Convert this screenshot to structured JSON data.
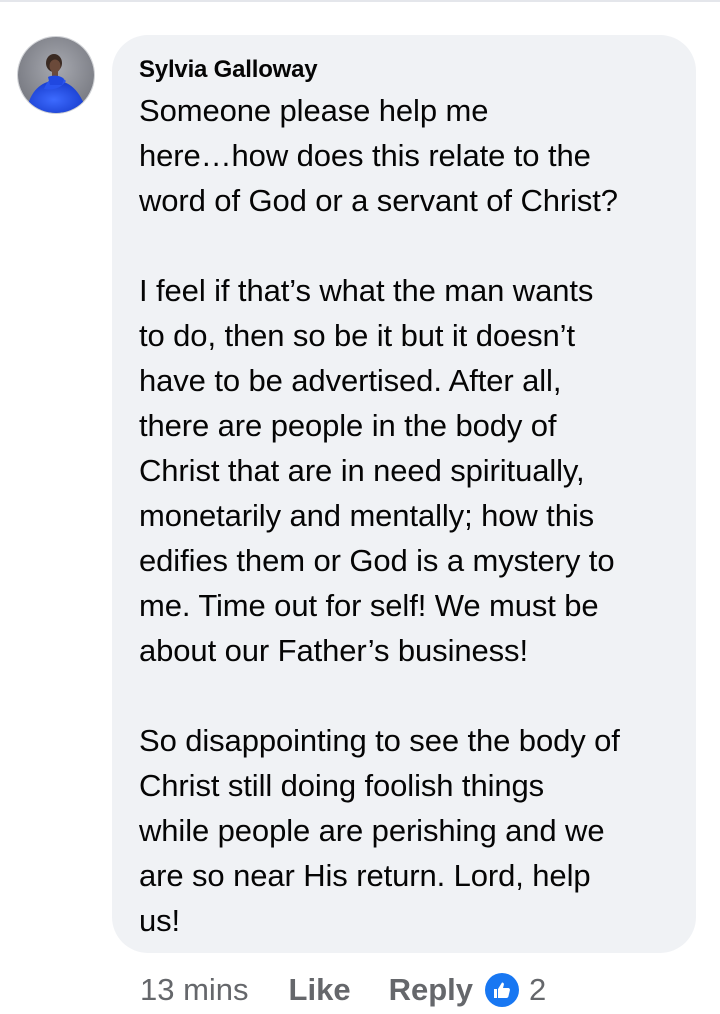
{
  "comment": {
    "author": "Sylvia Galloway",
    "text": "Someone please help me\nhere…how does this relate to the\nword of God or a servant of Christ?\n\nI feel if that’s what the man wants\nto do, then so be it but it doesn’t\nhave to be advertised. After all,\nthere are people in the body of\nChrist that are in need spiritually,\nmonetarily and mentally; how this\nedifies them or God is a mystery to\nme. Time out for self! We must be\nabout our Father’s business!\n\nSo disappointing to see the body of\nChrist still doing foolish things\nwhile people are perishing and we\nare so near His return. Lord, help\nus!",
    "avatar_icon": "profile-photo-avatar"
  },
  "actions": {
    "timestamp": "13 mins",
    "like_label": "Like",
    "reply_label": "Reply",
    "reaction_icon": "thumbs-up-icon",
    "reaction_count": "2"
  },
  "colors": {
    "bubble_bg": "#f0f2f5",
    "text": "#050505",
    "secondary_text": "#65676b",
    "like_blue": "#1877f2"
  }
}
